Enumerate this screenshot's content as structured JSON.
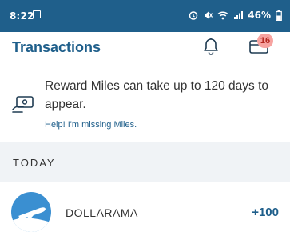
{
  "status_bar": {
    "time": "8:22",
    "battery": "46%"
  },
  "header": {
    "title": "Transactions",
    "badge_count": "16",
    "icons": [
      "bell-icon",
      "wallet-icon"
    ]
  },
  "info": {
    "message": "Reward Miles can take up to 120 days to appear.",
    "help_link": "Help! I'm missing Miles."
  },
  "section": {
    "label": "TODAY"
  },
  "transactions": [
    {
      "merchant": "DOLLARAMA",
      "amount": "+100",
      "icon": "airplane-icon"
    }
  ],
  "colors": {
    "brand": "#1f5f8b",
    "badge_bg": "#f7a3a0",
    "section_bg": "#f0f3f6"
  }
}
